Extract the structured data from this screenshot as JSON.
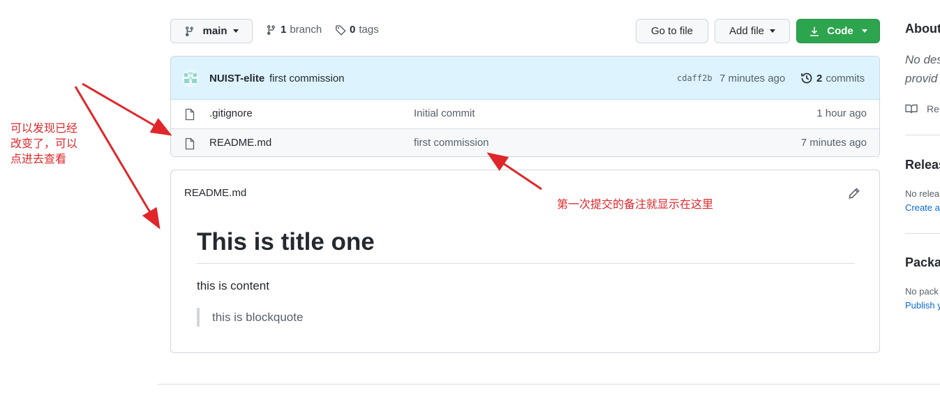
{
  "toolbar": {
    "branch_select": "main",
    "branch_count": "1",
    "branch_word": "branch",
    "tag_count": "0",
    "tag_word": "tags",
    "go_to_file": "Go to file",
    "add_file": "Add file",
    "code": "Code"
  },
  "commit": {
    "author": "NUIST-elite",
    "message": "first commission",
    "sha": "cdaff2b",
    "time": "7 minutes ago",
    "commits_count": "2",
    "commits_word": "commits"
  },
  "files": [
    {
      "name": ".gitignore",
      "message": "Initial commit",
      "time": "1 hour ago"
    },
    {
      "name": "README.md",
      "message": "first commission",
      "time": "7 minutes ago"
    }
  ],
  "readme": {
    "filename": "README.md",
    "heading": "This is title one",
    "paragraph": "this is content",
    "blockquote": "this is blockquote"
  },
  "sidebar": {
    "about_title": "About",
    "about_desc_1": "No des",
    "about_desc_2": "provid",
    "readme_link": "Re",
    "releases_title": "Releas",
    "releases_text": "No relea",
    "releases_link": "Create a",
    "packages_title": "Packa",
    "packages_text": "No pack",
    "packages_link": "Publish y"
  },
  "annotations": {
    "left_note": [
      "可以发现已经",
      "改变了，可以",
      "点进去查看"
    ],
    "right_note": "第一次提交的备注就显示在这里"
  },
  "colors": {
    "accent_green": "#2da44e",
    "link_blue": "#0969da",
    "annotation_red": "#e0262a",
    "commit_bar": "#ddf4ff"
  }
}
